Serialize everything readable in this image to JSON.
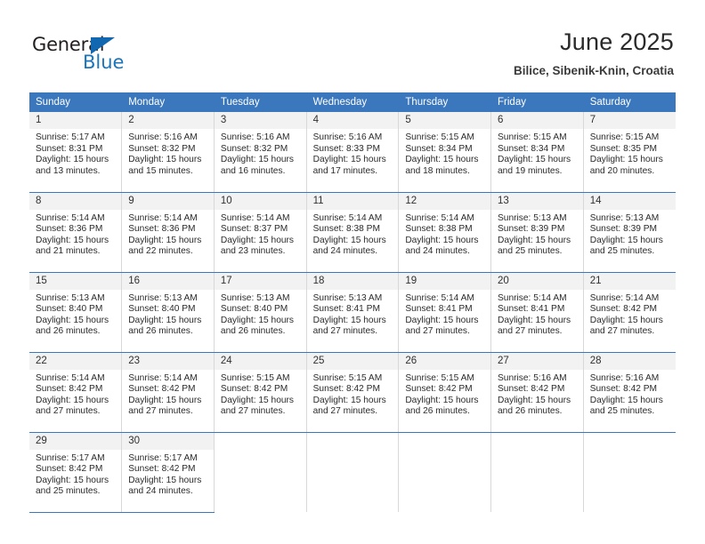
{
  "logo": {
    "word_top": "General",
    "word_bottom": "Blue",
    "triangle_color": "#1267b1",
    "blue_color": "#1b75bb",
    "dark_color": "#231f20"
  },
  "header": {
    "title": "June 2025",
    "subtitle": "Bilice, Sibenik-Knin, Croatia"
  },
  "theme": {
    "header_blue": "#3b77bc",
    "daynum_gray": "#f2f2f2",
    "column_divider": "#d8d8d8"
  },
  "calendar": {
    "weekday_headers": [
      "Sunday",
      "Monday",
      "Tuesday",
      "Wednesday",
      "Thursday",
      "Friday",
      "Saturday"
    ],
    "weeks": [
      [
        {
          "day": "1",
          "sunrise": "Sunrise: 5:17 AM",
          "sunset": "Sunset: 8:31 PM",
          "daylight": "Daylight: 15 hours and 13 minutes."
        },
        {
          "day": "2",
          "sunrise": "Sunrise: 5:16 AM",
          "sunset": "Sunset: 8:32 PM",
          "daylight": "Daylight: 15 hours and 15 minutes."
        },
        {
          "day": "3",
          "sunrise": "Sunrise: 5:16 AM",
          "sunset": "Sunset: 8:32 PM",
          "daylight": "Daylight: 15 hours and 16 minutes."
        },
        {
          "day": "4",
          "sunrise": "Sunrise: 5:16 AM",
          "sunset": "Sunset: 8:33 PM",
          "daylight": "Daylight: 15 hours and 17 minutes."
        },
        {
          "day": "5",
          "sunrise": "Sunrise: 5:15 AM",
          "sunset": "Sunset: 8:34 PM",
          "daylight": "Daylight: 15 hours and 18 minutes."
        },
        {
          "day": "6",
          "sunrise": "Sunrise: 5:15 AM",
          "sunset": "Sunset: 8:34 PM",
          "daylight": "Daylight: 15 hours and 19 minutes."
        },
        {
          "day": "7",
          "sunrise": "Sunrise: 5:15 AM",
          "sunset": "Sunset: 8:35 PM",
          "daylight": "Daylight: 15 hours and 20 minutes."
        }
      ],
      [
        {
          "day": "8",
          "sunrise": "Sunrise: 5:14 AM",
          "sunset": "Sunset: 8:36 PM",
          "daylight": "Daylight: 15 hours and 21 minutes."
        },
        {
          "day": "9",
          "sunrise": "Sunrise: 5:14 AM",
          "sunset": "Sunset: 8:36 PM",
          "daylight": "Daylight: 15 hours and 22 minutes."
        },
        {
          "day": "10",
          "sunrise": "Sunrise: 5:14 AM",
          "sunset": "Sunset: 8:37 PM",
          "daylight": "Daylight: 15 hours and 23 minutes."
        },
        {
          "day": "11",
          "sunrise": "Sunrise: 5:14 AM",
          "sunset": "Sunset: 8:38 PM",
          "daylight": "Daylight: 15 hours and 24 minutes."
        },
        {
          "day": "12",
          "sunrise": "Sunrise: 5:14 AM",
          "sunset": "Sunset: 8:38 PM",
          "daylight": "Daylight: 15 hours and 24 minutes."
        },
        {
          "day": "13",
          "sunrise": "Sunrise: 5:13 AM",
          "sunset": "Sunset: 8:39 PM",
          "daylight": "Daylight: 15 hours and 25 minutes."
        },
        {
          "day": "14",
          "sunrise": "Sunrise: 5:13 AM",
          "sunset": "Sunset: 8:39 PM",
          "daylight": "Daylight: 15 hours and 25 minutes."
        }
      ],
      [
        {
          "day": "15",
          "sunrise": "Sunrise: 5:13 AM",
          "sunset": "Sunset: 8:40 PM",
          "daylight": "Daylight: 15 hours and 26 minutes."
        },
        {
          "day": "16",
          "sunrise": "Sunrise: 5:13 AM",
          "sunset": "Sunset: 8:40 PM",
          "daylight": "Daylight: 15 hours and 26 minutes."
        },
        {
          "day": "17",
          "sunrise": "Sunrise: 5:13 AM",
          "sunset": "Sunset: 8:40 PM",
          "daylight": "Daylight: 15 hours and 26 minutes."
        },
        {
          "day": "18",
          "sunrise": "Sunrise: 5:13 AM",
          "sunset": "Sunset: 8:41 PM",
          "daylight": "Daylight: 15 hours and 27 minutes."
        },
        {
          "day": "19",
          "sunrise": "Sunrise: 5:14 AM",
          "sunset": "Sunset: 8:41 PM",
          "daylight": "Daylight: 15 hours and 27 minutes."
        },
        {
          "day": "20",
          "sunrise": "Sunrise: 5:14 AM",
          "sunset": "Sunset: 8:41 PM",
          "daylight": "Daylight: 15 hours and 27 minutes."
        },
        {
          "day": "21",
          "sunrise": "Sunrise: 5:14 AM",
          "sunset": "Sunset: 8:42 PM",
          "daylight": "Daylight: 15 hours and 27 minutes."
        }
      ],
      [
        {
          "day": "22",
          "sunrise": "Sunrise: 5:14 AM",
          "sunset": "Sunset: 8:42 PM",
          "daylight": "Daylight: 15 hours and 27 minutes."
        },
        {
          "day": "23",
          "sunrise": "Sunrise: 5:14 AM",
          "sunset": "Sunset: 8:42 PM",
          "daylight": "Daylight: 15 hours and 27 minutes."
        },
        {
          "day": "24",
          "sunrise": "Sunrise: 5:15 AM",
          "sunset": "Sunset: 8:42 PM",
          "daylight": "Daylight: 15 hours and 27 minutes."
        },
        {
          "day": "25",
          "sunrise": "Sunrise: 5:15 AM",
          "sunset": "Sunset: 8:42 PM",
          "daylight": "Daylight: 15 hours and 27 minutes."
        },
        {
          "day": "26",
          "sunrise": "Sunrise: 5:15 AM",
          "sunset": "Sunset: 8:42 PM",
          "daylight": "Daylight: 15 hours and 26 minutes."
        },
        {
          "day": "27",
          "sunrise": "Sunrise: 5:16 AM",
          "sunset": "Sunset: 8:42 PM",
          "daylight": "Daylight: 15 hours and 26 minutes."
        },
        {
          "day": "28",
          "sunrise": "Sunrise: 5:16 AM",
          "sunset": "Sunset: 8:42 PM",
          "daylight": "Daylight: 15 hours and 25 minutes."
        }
      ],
      [
        {
          "day": "29",
          "sunrise": "Sunrise: 5:17 AM",
          "sunset": "Sunset: 8:42 PM",
          "daylight": "Daylight: 15 hours and 25 minutes."
        },
        {
          "day": "30",
          "sunrise": "Sunrise: 5:17 AM",
          "sunset": "Sunset: 8:42 PM",
          "daylight": "Daylight: 15 hours and 24 minutes."
        },
        null,
        null,
        null,
        null,
        null
      ]
    ]
  }
}
